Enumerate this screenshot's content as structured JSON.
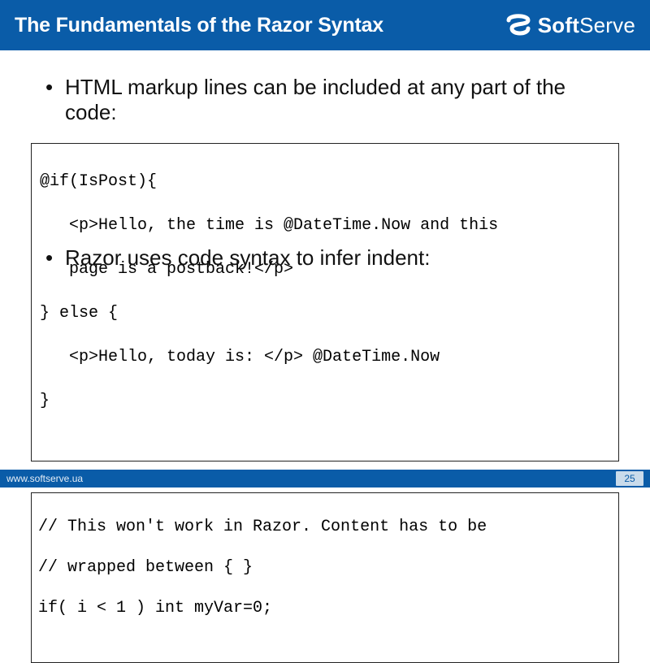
{
  "title": "The Fundamentals of the Razor Syntax",
  "brand": {
    "name_bold": "Soft",
    "name_light": "Serve"
  },
  "bullets": {
    "line1": "HTML markup lines can be included at any part of the code:",
    "line2": "Razor uses code syntax to infer indent:"
  },
  "code1": {
    "l1": "@if(IsPost){",
    "l2": "   <p>Hello, the time is @DateTime.Now and this",
    "l3": "   page is a postback!</p>",
    "l4": "} else {",
    "l5": "   <p>Hello, today is: </p> @DateTime.Now",
    "l6": "}"
  },
  "code2": {
    "l1": "// This won't work in Razor. Content has to be",
    "l2": "// wrapped between { }",
    "l3": "if( i < 1 ) int myVar=0;"
  },
  "footer": {
    "url": "www.softserve.ua",
    "page": "25"
  }
}
